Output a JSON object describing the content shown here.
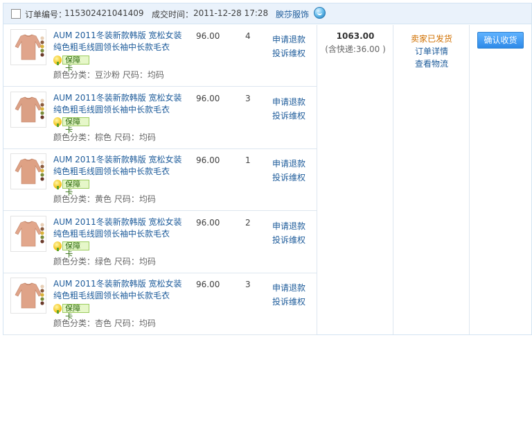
{
  "header": {
    "order_no_label": "订单编号：",
    "order_no": "115302421041409",
    "time_label": "成交时间：",
    "time": "2011-12-28 17:28",
    "shop_name": "腴莎服饰"
  },
  "items": [
    {
      "title": "AUM 2011冬装新款韩版 宽松女装纯色粗毛线圆领长袖中长款毛衣",
      "badge": "保障卡",
      "sku": "颜色分类：豆沙粉  尺码：均码",
      "price": "96.00",
      "qty": "4",
      "refund": "申请退款",
      "complain": "投诉维权",
      "sweater_color": "#e0a58c"
    },
    {
      "title": "AUM 2011冬装新款韩版 宽松女装纯色粗毛线圆领长袖中长款毛衣",
      "badge": "保障卡",
      "sku": "颜色分类：棕色  尺码：均码",
      "price": "96.00",
      "qty": "3",
      "refund": "申请退款",
      "complain": "投诉维权",
      "sweater_color": "#dba085"
    },
    {
      "title": "AUM 2011冬装新款韩版 宽松女装纯色粗毛线圆领长袖中长款毛衣",
      "badge": "保障卡",
      "sku": "颜色分类：黄色  尺码：均码",
      "price": "96.00",
      "qty": "1",
      "refund": "申请退款",
      "complain": "投诉维权",
      "sweater_color": "#dea184"
    },
    {
      "title": "AUM 2011冬装新款韩版 宽松女装纯色粗毛线圆领长袖中长款毛衣",
      "badge": "保障卡",
      "sku": "颜色分类：绿色  尺码：均码",
      "price": "96.00",
      "qty": "2",
      "refund": "申请退款",
      "complain": "投诉维权",
      "sweater_color": "#e2a78c"
    },
    {
      "title": "AUM 2011冬装新款韩版 宽松女装纯色粗毛线圆领长袖中长款毛衣",
      "badge": "保障卡",
      "sku": "颜色分类：杏色  尺码：均码",
      "price": "96.00",
      "qty": "3",
      "refund": "申请退款",
      "complain": "投诉维权",
      "sweater_color": "#dfa388"
    }
  ],
  "summary": {
    "total": "1063.00",
    "shipping": "(含快递:36.00 )",
    "status": "卖家已发货",
    "order_detail": "订单详情",
    "track": "查看物流",
    "confirm": "确认收货"
  },
  "colors": {
    "link": "#1d5b9a",
    "status": "#d07000",
    "header_bg": "#eaf2fb",
    "button": "#2e8ae8"
  }
}
